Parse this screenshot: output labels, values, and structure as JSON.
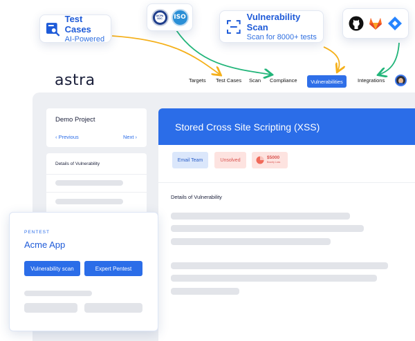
{
  "callouts": {
    "test_cases": {
      "title": "Test Cases",
      "subtitle": "AI-Powered"
    },
    "vuln_scan": {
      "title": "Vulnerability Scan",
      "subtitle": "Scan for 8000+ tests"
    },
    "badges": {
      "aicpa": "AICPA SOC",
      "iso": "ISO"
    }
  },
  "integrations_icons": [
    "github-icon",
    "gitlab-icon",
    "jira-icon"
  ],
  "navbar": {
    "logo": "astra",
    "items": [
      "Targets",
      "Test Cases",
      "Scan",
      "Compliance",
      "Vulnerabilities",
      "Integrations"
    ],
    "active": "Vulnerabilities"
  },
  "sidebar": {
    "project": "Demo Project",
    "previous": "‹  Previous",
    "next": "Next  ›",
    "details_label": "Details of Vulnerability"
  },
  "main": {
    "title": "Stored Cross Site Scripting (XSS)",
    "chips": {
      "email": "Email Team",
      "status": "Unsolved",
      "bounty_amount": "$5000",
      "bounty_label": "Bounty Loss"
    },
    "details_heading": "Details of Vulnerability"
  },
  "pentest": {
    "kicker": "PENTEST",
    "title": "Acme App",
    "buttons": [
      "Vulnerability scan",
      "Expert Pentest"
    ]
  },
  "colors": {
    "accent": "#2b6de8",
    "arrow_orange": "#f5b01a",
    "arrow_green": "#22b57a"
  }
}
